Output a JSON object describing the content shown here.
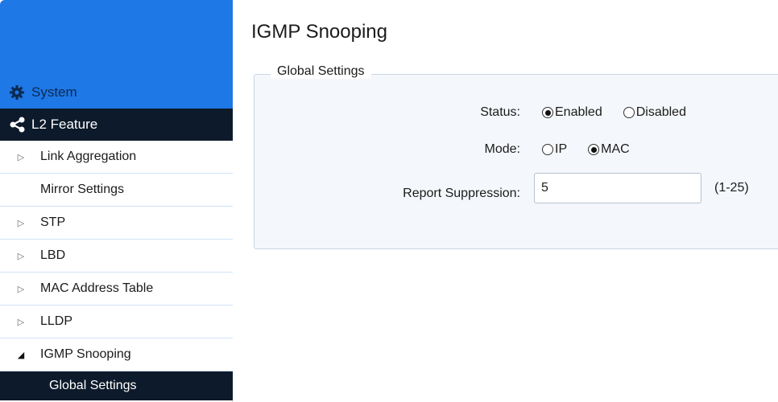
{
  "sidebar": {
    "system_label": "System",
    "l2_label": "L2 Feature",
    "items": [
      {
        "label": "Link Aggregation",
        "arrow": "▷"
      },
      {
        "label": "Mirror Settings",
        "arrow": ""
      },
      {
        "label": "STP",
        "arrow": "▷"
      },
      {
        "label": "LBD",
        "arrow": "▷"
      },
      {
        "label": "MAC Address Table",
        "arrow": "▷"
      },
      {
        "label": "LLDP",
        "arrow": "▷"
      },
      {
        "label": "IGMP Snooping",
        "arrow": "◢"
      }
    ],
    "active_sub": "Global Settings"
  },
  "main": {
    "title": "IGMP Snooping",
    "group_legend": "Global Settings",
    "status": {
      "label": "Status:",
      "options": [
        "Enabled",
        "Disabled"
      ],
      "selected": "Enabled"
    },
    "mode": {
      "label": "Mode:",
      "options": [
        "IP",
        "MAC"
      ],
      "selected": "MAC"
    },
    "report_suppression": {
      "label": "Report Suppression:",
      "value": "5",
      "range": "(1-25)"
    }
  },
  "colors": {
    "banner": "#1e78e6",
    "dark_nav": "#0d1a2b"
  }
}
